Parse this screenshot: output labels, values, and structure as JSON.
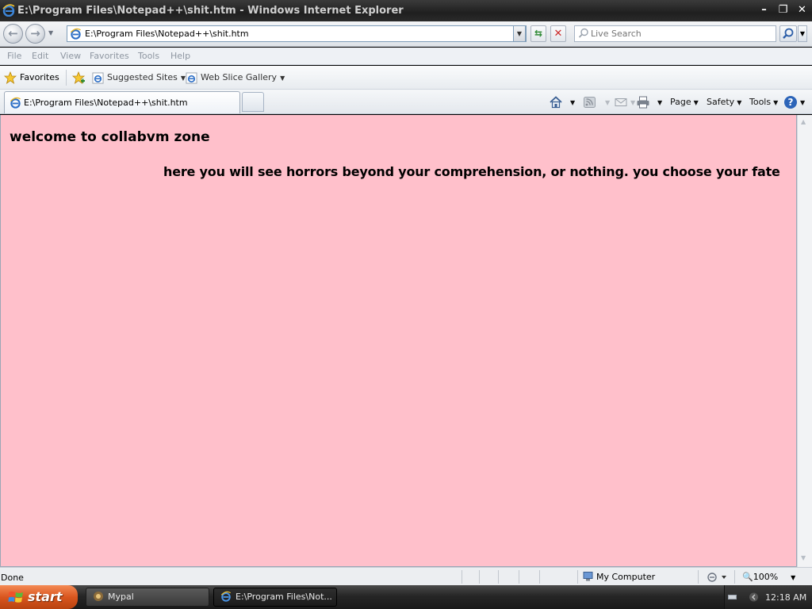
{
  "window": {
    "title": "E:\\Program Files\\Notepad++\\shit.htm - Windows Internet Explorer"
  },
  "address_bar": {
    "url": "E:\\Program Files\\Notepad++\\shit.htm"
  },
  "search": {
    "placeholder": "Live Search"
  },
  "menu": [
    "File",
    "Edit",
    "View",
    "Favorites",
    "Tools",
    "Help"
  ],
  "favorites_bar": {
    "favorites_label": "Favorites",
    "links": [
      "Suggested Sites",
      "Web Slice Gallery"
    ]
  },
  "tab": {
    "label": "E:\\Program Files\\Notepad++\\shit.htm"
  },
  "command_bar": {
    "page": "Page",
    "safety": "Safety",
    "tools": "Tools"
  },
  "page": {
    "background": "#ffc0cb",
    "heading": "welcome to collabvm zone",
    "text": "here you will see horrors beyond your comprehension, or nothing. you choose your fate"
  },
  "status_bar": {
    "status": "Done",
    "zone": "My Computer",
    "zoom": "100%"
  },
  "taskbar": {
    "start_label": "start",
    "tasks": [
      "Mypal",
      "E:\\Program Files\\Not..."
    ],
    "clock": "12:18 AM"
  }
}
